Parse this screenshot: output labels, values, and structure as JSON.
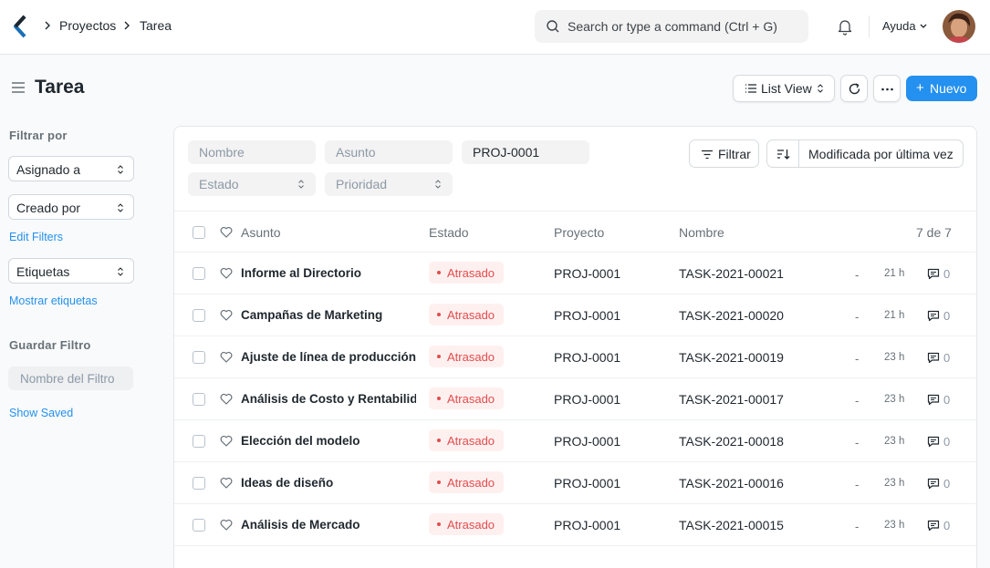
{
  "navbar": {
    "breadcrumbs": [
      "Proyectos",
      "Tarea"
    ],
    "search_placeholder": "Search or type a command (Ctrl + G)",
    "help_label": "Ayuda"
  },
  "page": {
    "title": "Tarea",
    "list_view_label": "List View",
    "new_label": "Nuevo"
  },
  "sidebar": {
    "filter_by_label": "Filtrar por",
    "assigned_to": "Asignado a",
    "created_by": "Creado por",
    "edit_filters": "Edit Filters",
    "tags": "Etiquetas",
    "show_tags": "Mostrar etiquetas",
    "save_filter_label": "Guardar Filtro",
    "filter_name_placeholder": "Nombre del Filtro",
    "show_saved": "Show Saved"
  },
  "filters": {
    "name_placeholder": "Nombre",
    "subject_placeholder": "Asunto",
    "project_value": "PROJ-0001",
    "status_placeholder": "Estado",
    "priority_placeholder": "Prioridad",
    "filter_button": "Filtrar",
    "sort_label": "Modificada por última vez"
  },
  "table": {
    "headers": {
      "subject": "Asunto",
      "status": "Estado",
      "project": "Proyecto",
      "name": "Nombre"
    },
    "count": "7 de 7",
    "rows": [
      {
        "subject": "Informe al Directorio",
        "status": "Atrasado",
        "project": "PROJ-0001",
        "name": "TASK-2021-00021",
        "dash": "-",
        "time": "21 h",
        "comments": "0"
      },
      {
        "subject": "Campañas de Marketing",
        "status": "Atrasado",
        "project": "PROJ-0001",
        "name": "TASK-2021-00020",
        "dash": "-",
        "time": "21 h",
        "comments": "0"
      },
      {
        "subject": "Ajuste de línea de producción",
        "status": "Atrasado",
        "project": "PROJ-0001",
        "name": "TASK-2021-00019",
        "dash": "-",
        "time": "23 h",
        "comments": "0"
      },
      {
        "subject": "Análisis de Costo y Rentabilidad",
        "status": "Atrasado",
        "project": "PROJ-0001",
        "name": "TASK-2021-00017",
        "dash": "-",
        "time": "23 h",
        "comments": "0"
      },
      {
        "subject": "Elección del modelo",
        "status": "Atrasado",
        "project": "PROJ-0001",
        "name": "TASK-2021-00018",
        "dash": "-",
        "time": "23 h",
        "comments": "0"
      },
      {
        "subject": "Ideas de diseño",
        "status": "Atrasado",
        "project": "PROJ-0001",
        "name": "TASK-2021-00016",
        "dash": "-",
        "time": "23 h",
        "comments": "0"
      },
      {
        "subject": "Análisis de Mercado",
        "status": "Atrasado",
        "project": "PROJ-0001",
        "name": "TASK-2021-00015",
        "dash": "-",
        "time": "23 h",
        "comments": "0"
      }
    ]
  },
  "colors": {
    "primary": "#2490ef",
    "overdue": "#e24c4c",
    "overdue_bg": "#fff0f0"
  },
  "icons": [
    "app-logo-icon",
    "chevron-right-icon",
    "search-icon",
    "bell-icon",
    "chevron-down-icon",
    "menu-icon",
    "list-icon",
    "sort-icon",
    "refresh-icon",
    "more-icon",
    "plus-icon",
    "filter-icon",
    "sort-order-icon",
    "heart-icon",
    "comment-icon"
  ]
}
